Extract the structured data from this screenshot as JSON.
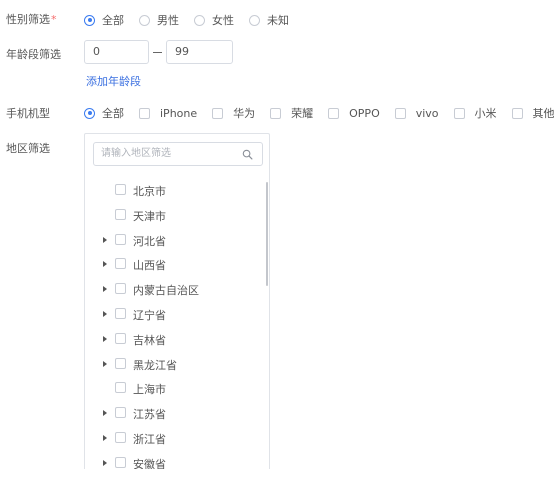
{
  "gender": {
    "label": "性别筛选",
    "required_mark": "*",
    "options": [
      "全部",
      "男性",
      "女性",
      "未知"
    ],
    "selected": "全部"
  },
  "age": {
    "label": "年龄段筛选",
    "min": "0",
    "max": "99",
    "add_link": "添加年龄段"
  },
  "device": {
    "label": "手机机型",
    "all_option": "全部",
    "selected": "全部",
    "options": [
      "iPhone",
      "华为",
      "荣耀",
      "OPPO",
      "vivo",
      "小米",
      "其他机型"
    ]
  },
  "region": {
    "label": "地区筛选",
    "search_placeholder": "请输入地区筛选",
    "items": [
      {
        "label": "北京市",
        "expandable": false
      },
      {
        "label": "天津市",
        "expandable": false
      },
      {
        "label": "河北省",
        "expandable": true
      },
      {
        "label": "山西省",
        "expandable": true
      },
      {
        "label": "内蒙古自治区",
        "expandable": true
      },
      {
        "label": "辽宁省",
        "expandable": true
      },
      {
        "label": "吉林省",
        "expandable": true
      },
      {
        "label": "黑龙江省",
        "expandable": true
      },
      {
        "label": "上海市",
        "expandable": false
      },
      {
        "label": "江苏省",
        "expandable": true
      },
      {
        "label": "浙江省",
        "expandable": true
      },
      {
        "label": "安徽省",
        "expandable": true
      }
    ]
  },
  "colors": {
    "accent": "#3a7bf0",
    "link": "#3a6fe0",
    "required": "#f56c6c"
  },
  "icons": {
    "search": "search-icon",
    "caret": "caret-right-icon"
  }
}
